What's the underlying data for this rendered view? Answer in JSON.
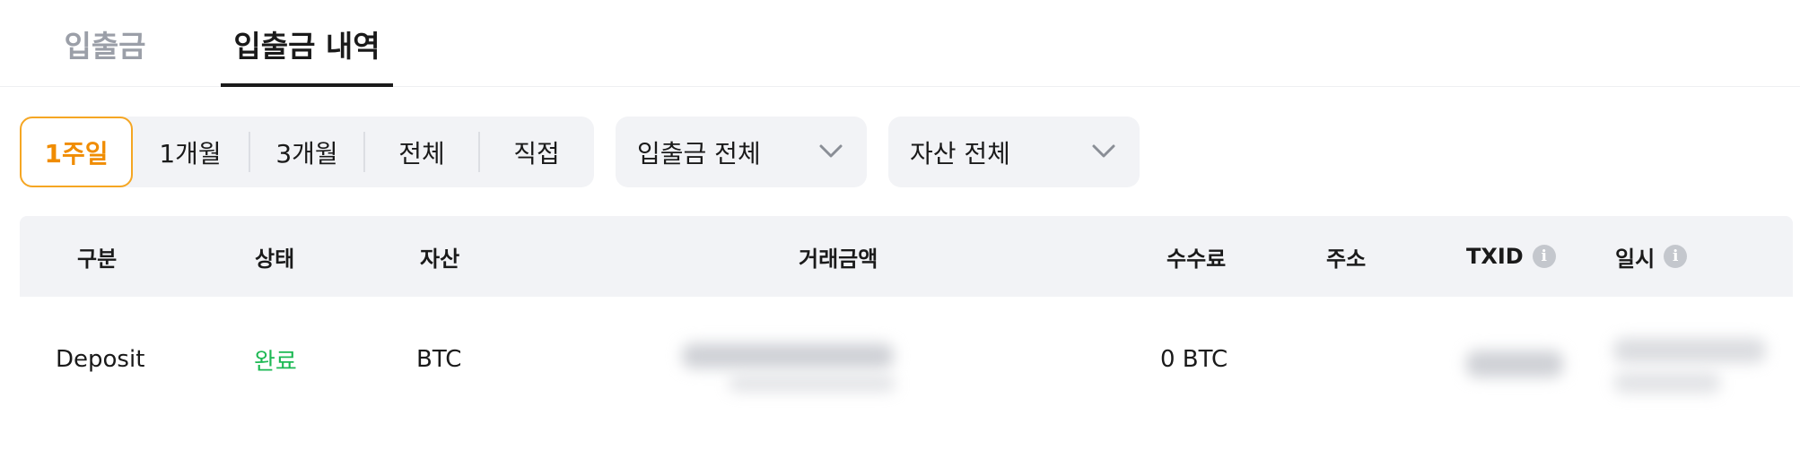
{
  "tabs": [
    {
      "label": "입출금",
      "active": false
    },
    {
      "label": "입출금 내역",
      "active": true
    }
  ],
  "period_filter": {
    "items": [
      "1주일",
      "1개월",
      "3개월",
      "전체",
      "직접"
    ],
    "selected": "1주일"
  },
  "type_dropdown": {
    "value": "입출금 전체",
    "icon": "chevron-down-icon"
  },
  "asset_dropdown": {
    "value": "자산 전체",
    "icon": "chevron-down-icon"
  },
  "table": {
    "headers": {
      "type": "구분",
      "status": "상태",
      "asset": "자산",
      "amount": "거래금액",
      "fee": "수수료",
      "address": "주소",
      "txid": "TXID",
      "datetime": "일시"
    },
    "info_icon": "info-icon",
    "rows": [
      {
        "type": "Deposit",
        "status": "완료",
        "asset": "BTC",
        "fee": "0 BTC"
      }
    ]
  },
  "colors": {
    "accent": "#f08c00",
    "accent_border": "#f5a623",
    "status_done": "#1db954",
    "panel_bg": "#f2f3f6"
  }
}
